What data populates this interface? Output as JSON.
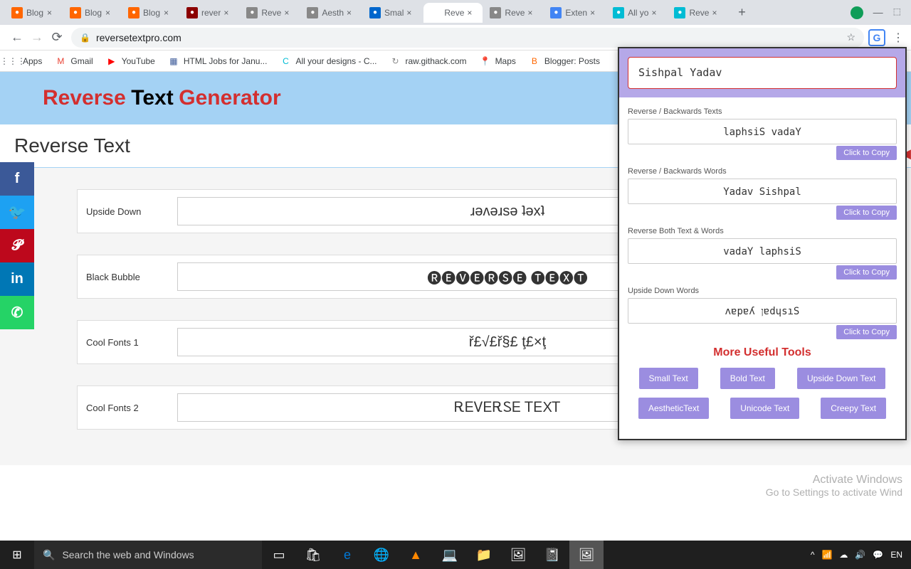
{
  "browser": {
    "tabs": [
      {
        "title": "Blog",
        "bg": "#ff6600"
      },
      {
        "title": "Blog",
        "bg": "#ff6600"
      },
      {
        "title": "Blog",
        "bg": "#ff6600"
      },
      {
        "title": "rever",
        "bg": "#8b0000"
      },
      {
        "title": "Reve",
        "bg": "#888"
      },
      {
        "title": "Aesth",
        "bg": "#888"
      },
      {
        "title": "Smal",
        "bg": "#0066cc"
      },
      {
        "title": "Reve",
        "bg": "#fff",
        "active": true
      },
      {
        "title": "Reve",
        "bg": "#888"
      },
      {
        "title": "Exten",
        "bg": "#4285f4"
      },
      {
        "title": "All yo",
        "bg": "#00bcd4"
      },
      {
        "title": "Reve",
        "bg": "#00bcd4"
      }
    ],
    "url": "reversetextpro.com"
  },
  "bookmarks": [
    {
      "label": "Apps",
      "icon": "⋮⋮⋮",
      "color": "#5f6368"
    },
    {
      "label": "Gmail",
      "icon": "M",
      "color": "#ea4335"
    },
    {
      "label": "YouTube",
      "icon": "▶",
      "color": "#ff0000"
    },
    {
      "label": "HTML Jobs for Janu...",
      "icon": "▦",
      "color": "#3b5998"
    },
    {
      "label": "All your designs - C...",
      "icon": "C",
      "color": "#00bcd4"
    },
    {
      "label": "raw.githack.com",
      "icon": "↻",
      "color": "#888"
    },
    {
      "label": "Maps",
      "icon": "📍",
      "color": "#34a853"
    },
    {
      "label": "Blogger: Posts",
      "icon": "B",
      "color": "#ff6600"
    }
  ],
  "page": {
    "title_w1": "Reverse",
    "title_w2": "Text",
    "title_w3": "Generator",
    "section_title": "Reverse Text"
  },
  "cards": [
    {
      "label": "Upside Down",
      "output": "ɹǝʌǝɹsǝ ʇǝxʇ"
    },
    {
      "label": "Black Bubble",
      "output": "🅡🅔🅥🅔🅡🅢🅔 🅣🅔🅧🅣"
    },
    {
      "label": "Cool Fonts 1",
      "output": "ř£√£ř§£ ţ£×ţ"
    },
    {
      "label": "Cool Fonts 2",
      "output": "ᎡᎬᏙᎬᎡᏚᎬ ᎢᎬXᎢ"
    }
  ],
  "ext": {
    "input_value": "Sishpal Yadav",
    "sections": [
      {
        "label": "Reverse / Backwards Texts",
        "value": "laphsiS vadaY"
      },
      {
        "label": "Reverse / Backwards Words",
        "value": "Yadav Sishpal"
      },
      {
        "label": "Reverse Both Text & Words",
        "value": "vadaY laphsiS"
      },
      {
        "label": "Upside Down Words",
        "value": "ʌɐpɐʎ ןɐdɥsıS"
      }
    ],
    "copy_label": "Click to Copy",
    "more_label": "More Useful Tools",
    "tools_row1": [
      "Small Text",
      "Bold Text",
      "Upside Down Text"
    ],
    "tools_row2": [
      "AestheticText",
      "Unicode Text",
      "Creepy Text"
    ]
  },
  "watermark": {
    "line1": "Activate Windows",
    "line2": "Go to Settings to activate Wind"
  },
  "taskbar": {
    "search_placeholder": "Search the web and Windows",
    "time": "EN"
  }
}
